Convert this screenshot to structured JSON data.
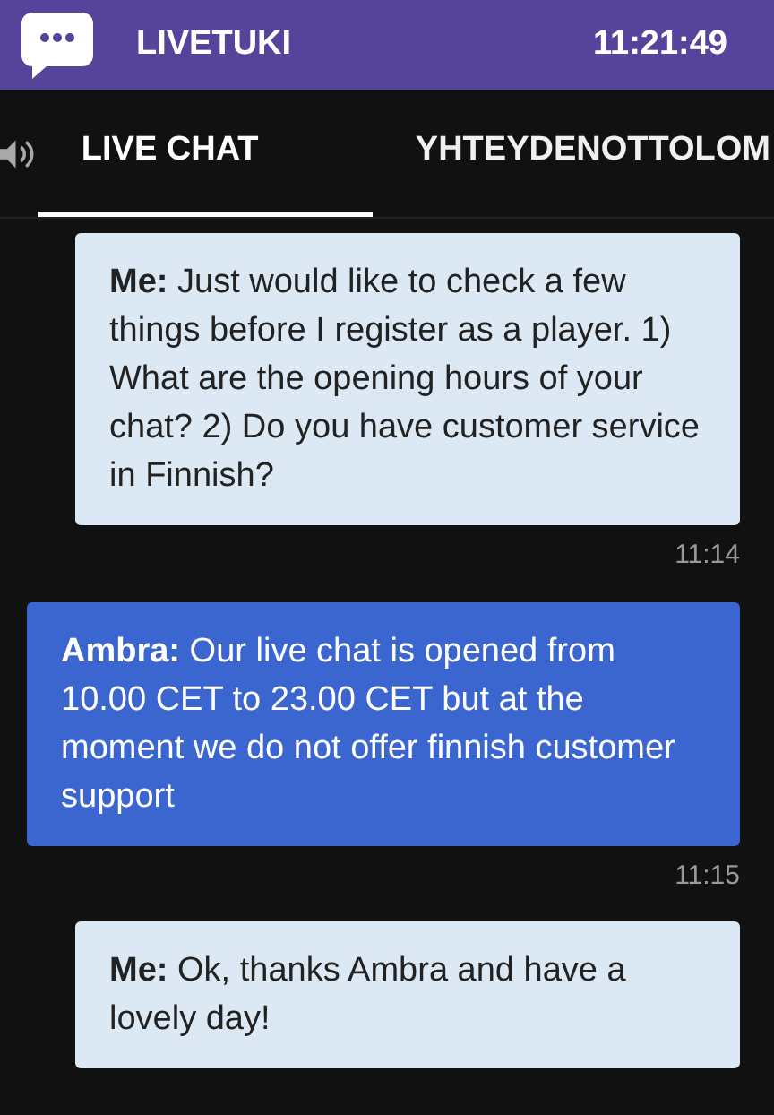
{
  "header": {
    "title": "LIVETUKI",
    "clock": "11:21:49"
  },
  "tabs": [
    {
      "label": "LIVE CHAT",
      "selected": true
    },
    {
      "label": "YHTEYDENOTTOLOM",
      "selected": false
    }
  ],
  "messages": [
    {
      "kind": "visitor",
      "text": "**Me:** Just would like to check a few things before I register as a player. 1) What are the opening hours of your chat? 2) Do you have customer service in Finnish?",
      "time": "11:14"
    },
    {
      "kind": "agent",
      "text": "**Ambra:** Our live chat is opened from 10.00 CET to 23.00 CET but at the moment we do not offer finnish customer support",
      "time": "11:15"
    },
    {
      "kind": "visitor",
      "text": "**Me:** Ok, thanks Ambra and have a lovely day!"
    }
  ]
}
